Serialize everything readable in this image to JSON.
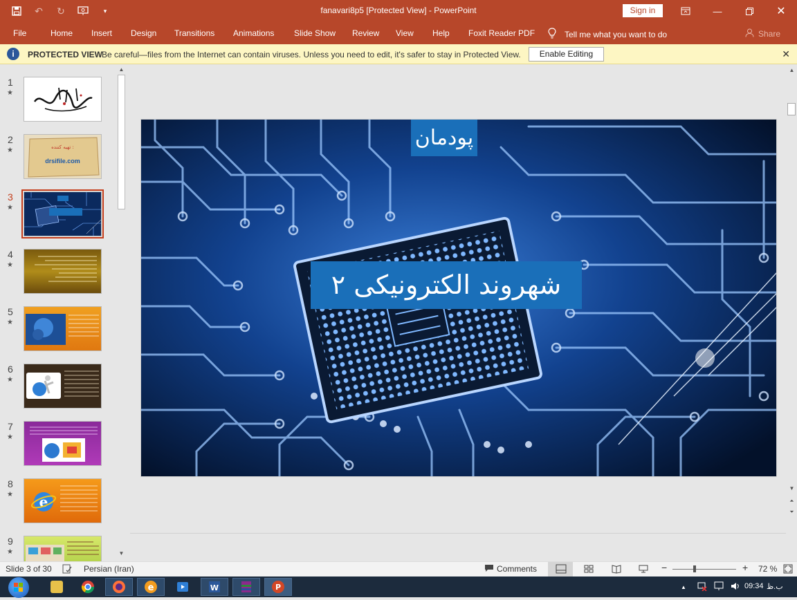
{
  "titlebar": {
    "title": "fanavari8p5 [Protected View]  -  PowerPoint",
    "sign_in": "Sign in"
  },
  "ribbon": {
    "tabs": [
      "File",
      "Home",
      "Insert",
      "Design",
      "Transitions",
      "Animations",
      "Slide Show",
      "Review",
      "View",
      "Help",
      "Foxit Reader PDF"
    ],
    "tell_me": "Tell me what you want to do",
    "share": "Share"
  },
  "protected_view": {
    "title": "PROTECTED VIEW",
    "message": "Be careful—files from the Internet can contain viruses. Unless you need to edit, it's safer to stay in Protected View.",
    "enable_button": "Enable Editing"
  },
  "thumbnails": [
    {
      "num": "1",
      "star": "★"
    },
    {
      "num": "2",
      "star": "★",
      "text1": "تهیه کننده :",
      "text2": "drsifile.com"
    },
    {
      "num": "3",
      "star": "★"
    },
    {
      "num": "4",
      "star": "★"
    },
    {
      "num": "5",
      "star": "★"
    },
    {
      "num": "6",
      "star": "★"
    },
    {
      "num": "7",
      "star": "★"
    },
    {
      "num": "8",
      "star": "★"
    },
    {
      "num": "9",
      "star": "★"
    }
  ],
  "slide": {
    "top_label": "پودمان",
    "main_title": "شهروند الکترونیکی ۲"
  },
  "statusbar": {
    "slide_info": "Slide 3 of 30",
    "language": "Persian (Iran)",
    "comments": "Comments",
    "zoom": "72 %"
  },
  "taskbar": {
    "time": "09:34",
    "ampm": "ب.ظ"
  }
}
